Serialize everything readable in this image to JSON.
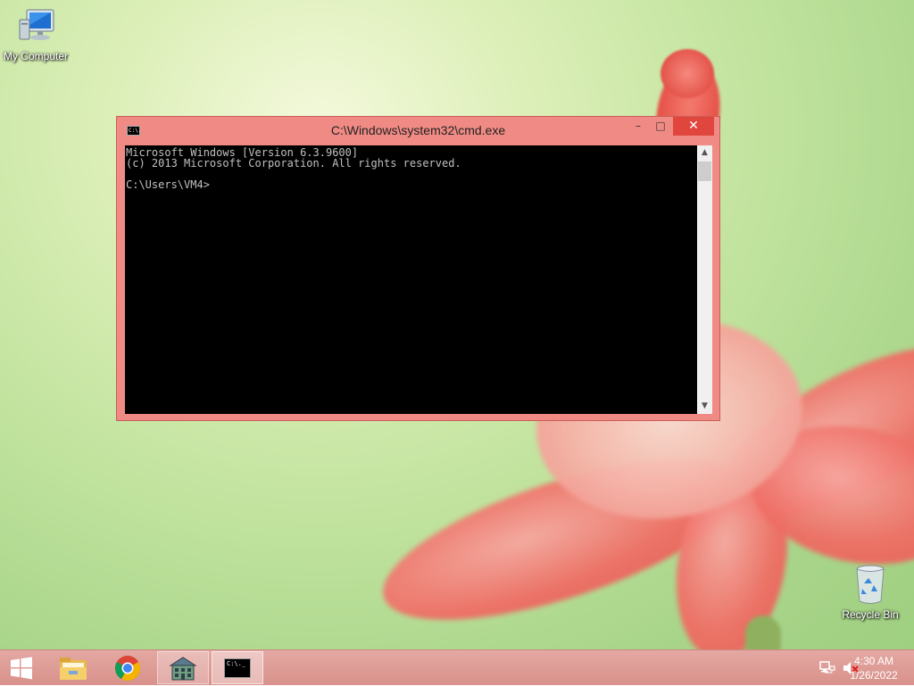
{
  "desktop": {
    "icons": [
      {
        "label": "My Computer",
        "icon": "computer-icon"
      },
      {
        "label": "Recycle Bin",
        "icon": "recycle-bin-icon"
      }
    ]
  },
  "cmd_window": {
    "title": "C:\\Windows\\system32\\cmd.exe",
    "title_icon_text": "C:\\.",
    "console_lines": [
      "Microsoft Windows [Version 6.3.9600]",
      "(c) 2013 Microsoft Corporation. All rights reserved.",
      "",
      "C:\\Users\\VM4>"
    ],
    "buttons": {
      "minimize": "–",
      "maximize": "□",
      "close": "✕"
    },
    "scrollbar": {
      "up": "▲",
      "down": "▼"
    }
  },
  "taskbar": {
    "items": [
      {
        "name": "start",
        "icon": "windows-logo-icon"
      },
      {
        "name": "file-explorer",
        "icon": "folder-icon"
      },
      {
        "name": "chrome",
        "icon": "chrome-icon"
      },
      {
        "name": "app",
        "icon": "building-icon"
      },
      {
        "name": "cmd",
        "icon": "cmd-icon",
        "icon_text": "C:\\._"
      }
    ],
    "tray": {
      "network_icon": "network-icon",
      "volume_icon": "volume-muted-icon"
    },
    "clock": {
      "time": "4:30 AM",
      "date": "1/26/2022"
    }
  },
  "colors": {
    "window_frame": "#f08a84",
    "close_button": "#e0463d",
    "console_background": "#000000",
    "console_text": "#c0c0c0",
    "taskbar": "#d9918b"
  }
}
